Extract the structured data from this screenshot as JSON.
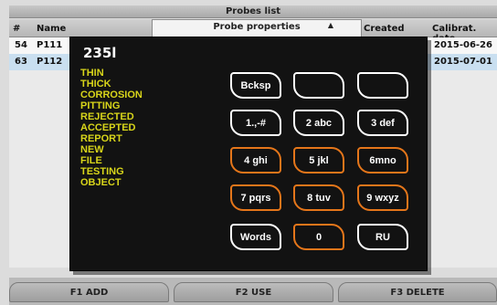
{
  "probes_list": {
    "title": "Probes list",
    "columns": {
      "num": "#",
      "name": "Name",
      "created": "Created",
      "calibration": "Calibrat. date"
    },
    "properties_header": "Probe properties",
    "rows": [
      {
        "num": "54",
        "name": "P111",
        "calibration": "2015-06-26"
      },
      {
        "num": "63",
        "name": "P112",
        "calibration": "2015-07-01"
      }
    ]
  },
  "keypad": {
    "entry_text": "235l",
    "suggestions": [
      "THIN",
      "THICK",
      "CORROSION",
      "PITTING",
      "REJECTED",
      "ACCEPTED",
      "REPORT",
      "NEW",
      "FILE",
      "TESTING",
      "OBJECT"
    ],
    "keys": [
      {
        "label": "Bcksp",
        "color": "white"
      },
      {
        "label": "",
        "color": "white"
      },
      {
        "label": "",
        "color": "white"
      },
      {
        "label": "1.,-#",
        "color": "white"
      },
      {
        "label": "2 abc",
        "color": "white"
      },
      {
        "label": "3 def",
        "color": "white"
      },
      {
        "label": "4 ghi",
        "color": "orange"
      },
      {
        "label": "5 jkl",
        "color": "orange"
      },
      {
        "label": "6mno",
        "color": "orange"
      },
      {
        "label": "7 pqrs",
        "color": "orange"
      },
      {
        "label": "8 tuv",
        "color": "orange"
      },
      {
        "label": "9 wxyz",
        "color": "orange"
      },
      {
        "label": "Words",
        "color": "white"
      },
      {
        "label": "0",
        "color": "orange"
      },
      {
        "label": "RU",
        "color": "white"
      }
    ]
  },
  "function_bar": {
    "f1": "F1 ADD",
    "f2": "F2 USE",
    "f3": "F3 DELETE"
  },
  "colors": {
    "accent_orange": "#e5761a",
    "word_yellow": "#d8d51a",
    "selected_row": "#c9dff0"
  }
}
